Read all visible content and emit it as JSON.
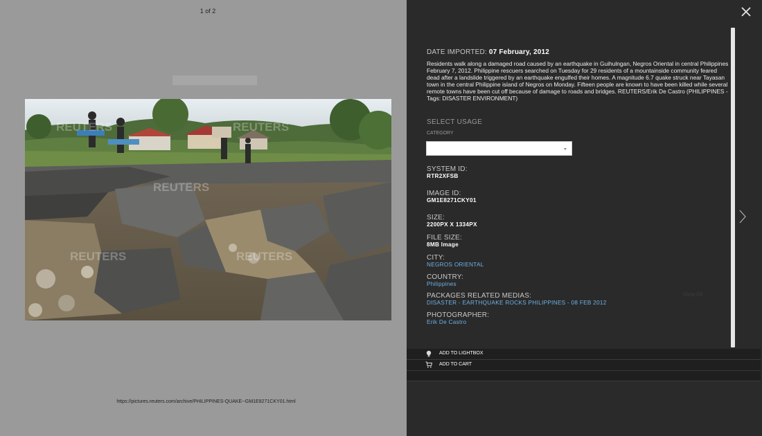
{
  "viewer": {
    "counter": "1 of 2",
    "watermark": "REUTERS",
    "url": "https://pictures.reuters.com/archive/PHILIPPINES-QUAKE--GM1E8271CKY01.html"
  },
  "details": {
    "date_label": "DATE IMPORTED:",
    "date_value": "07 February, 2012",
    "caption": "Residents walk along a damaged road caused by an earthquake in Guihulngan, Negros Oriental in central Philippines February 7, 2012. Philippine rescuers searched on Tuesday for 29 residents of a mountainside community feared dead after a landslide triggered by an earthquake engulfed their homes. A magnitude 6.7 quake struck near Tayasan town in the central Philippine island of Negros on Monday. Fifteen people are known to have been killed while several remote towns have been cut off because of damage to roads and bridges. REUTERS/Erik De Castro (PHILIPPINES - Tags: DISASTER ENVIRONMENT)",
    "select_usage_title": "SELECT USAGE",
    "category_label": "CATEGORY",
    "category_value": "",
    "fields": {
      "system_id": {
        "label": "SYSTEM ID:",
        "value": "RTR2XFSB"
      },
      "image_id": {
        "label": "IMAGE ID:",
        "value": "GM1E8271CKY01"
      },
      "size": {
        "label": "SIZE:",
        "value": "2200PX X 1334PX"
      },
      "file_size": {
        "label": "FILE SIZE:",
        "value": "8MB Image"
      },
      "city": {
        "label": "CITY:",
        "value": "NEGROS ORIENTAL"
      },
      "country": {
        "label": "COUNTRY:",
        "value": "Philippines"
      },
      "packages": {
        "label": "PACKAGES RELATED MEDIAS:",
        "value": "DISASTER - EARTHQUAKE ROCKS PHILIPPINES - 08 FEB 2012"
      },
      "photographer": {
        "label": "PHOTOGRAPHER:",
        "value": "Erik De Castro"
      }
    },
    "view_all": "View All"
  },
  "actions": {
    "lightbox": "ADD TO LIGHTBOX",
    "cart": "ADD TO CART"
  },
  "icons": {
    "close": "close-icon",
    "next": "chevron-right-icon",
    "lightbox": "lightbulb-icon",
    "cart": "cart-icon"
  },
  "colors": {
    "left_bg": "#9a9a9a",
    "panel_bg": "#2a2a2a",
    "link": "#6fb2e8"
  }
}
